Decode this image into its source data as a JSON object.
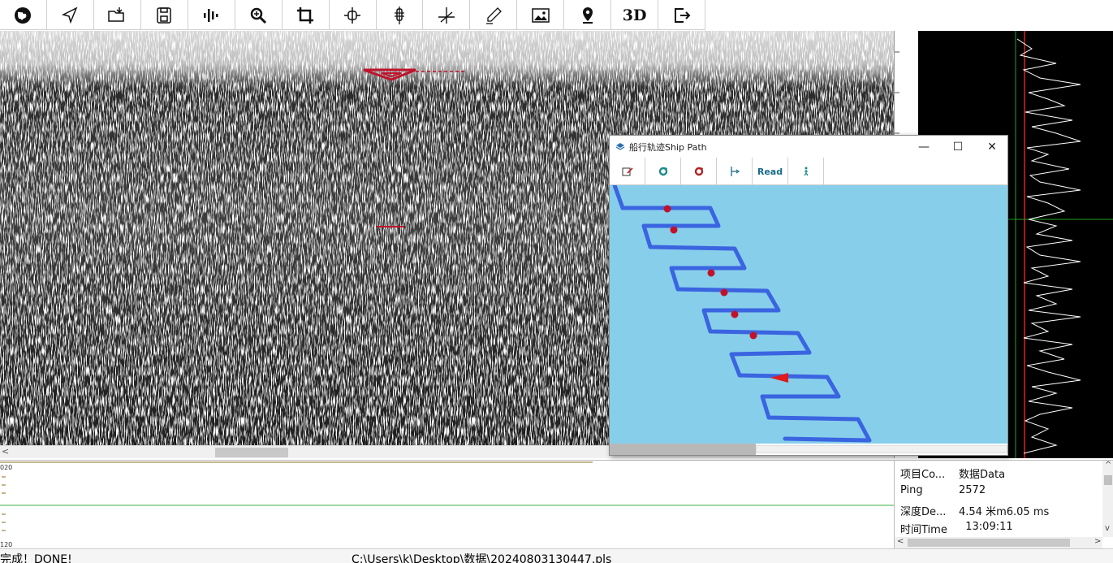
{
  "toolbar": {
    "buttons": [
      {
        "icon": "globe-icon"
      },
      {
        "icon": "navigate-arrow-icon"
      },
      {
        "icon": "open-folder-icon"
      },
      {
        "icon": "save-icon"
      },
      {
        "icon": "waveform-icon"
      },
      {
        "icon": "zoom-icon"
      },
      {
        "icon": "crop-icon"
      },
      {
        "icon": "target-icon"
      },
      {
        "icon": "depth-marker-icon"
      },
      {
        "icon": "axis-icon"
      },
      {
        "icon": "pen-icon"
      },
      {
        "icon": "image-icon"
      },
      {
        "icon": "map-pin-icon"
      },
      {
        "icon": "3d-text",
        "label": "3D"
      },
      {
        "icon": "exit-icon"
      }
    ]
  },
  "ship_window": {
    "title": "船行轨迹Ship Path",
    "minimize": "—",
    "maximize": "☐",
    "close": "✕",
    "tools": [
      {
        "icon": "edit-icon"
      },
      {
        "icon": "refresh-icon",
        "color": "#1b8a8a"
      },
      {
        "icon": "refresh-red-icon",
        "color": "#b22222"
      },
      {
        "icon": "path-icon"
      },
      {
        "icon": "read-text",
        "label": "Read"
      },
      {
        "icon": "walker-icon"
      }
    ],
    "map_bg": "#87ceeb",
    "track_color": "#3a64e0",
    "marker_color": "#c0132b"
  },
  "strip": {
    "top_label": "020",
    "bottom_label": "120"
  },
  "info": {
    "rows": [
      {
        "key": "项目Co...",
        "value": "数据Data"
      },
      {
        "key": "Ping",
        "value": "2572"
      },
      {
        "key": "深度De...",
        "value": "4.54 米m6.05 ms"
      },
      {
        "key": "时间Time",
        "value": "  13:09:11"
      }
    ]
  },
  "status": {
    "message": "完成！DONE!",
    "path": "C:\\Users\\k\\Desktop\\数据\\20240803130447.pls"
  },
  "scroll": {
    "left_arrow": "<",
    "right_arrow": ">",
    "up_arrow": "^",
    "down_arrow": "v"
  }
}
